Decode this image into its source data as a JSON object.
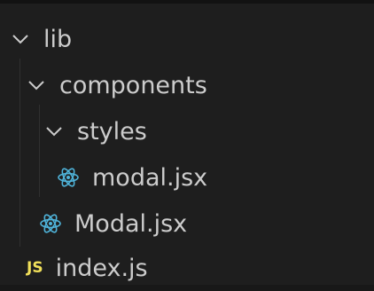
{
  "explorer": {
    "items": [
      {
        "name": "lib",
        "kind": "folder",
        "expanded": true,
        "icon": "chevron-down-icon"
      },
      {
        "name": "components",
        "kind": "folder",
        "expanded": true,
        "icon": "chevron-down-icon"
      },
      {
        "name": "styles",
        "kind": "folder",
        "expanded": true,
        "icon": "chevron-down-icon"
      },
      {
        "name": "modal.jsx",
        "kind": "file",
        "icon": "react-icon"
      },
      {
        "name": "Modal.jsx",
        "kind": "file",
        "icon": "react-icon"
      },
      {
        "name": "index.js",
        "kind": "file",
        "icon": "js-file-icon",
        "badge": "JS"
      }
    ]
  },
  "colors": {
    "background": "#1e1e1e",
    "text": "#cccccc",
    "react_icon": "#4fb3d9",
    "js_badge": "#f1e05a"
  }
}
